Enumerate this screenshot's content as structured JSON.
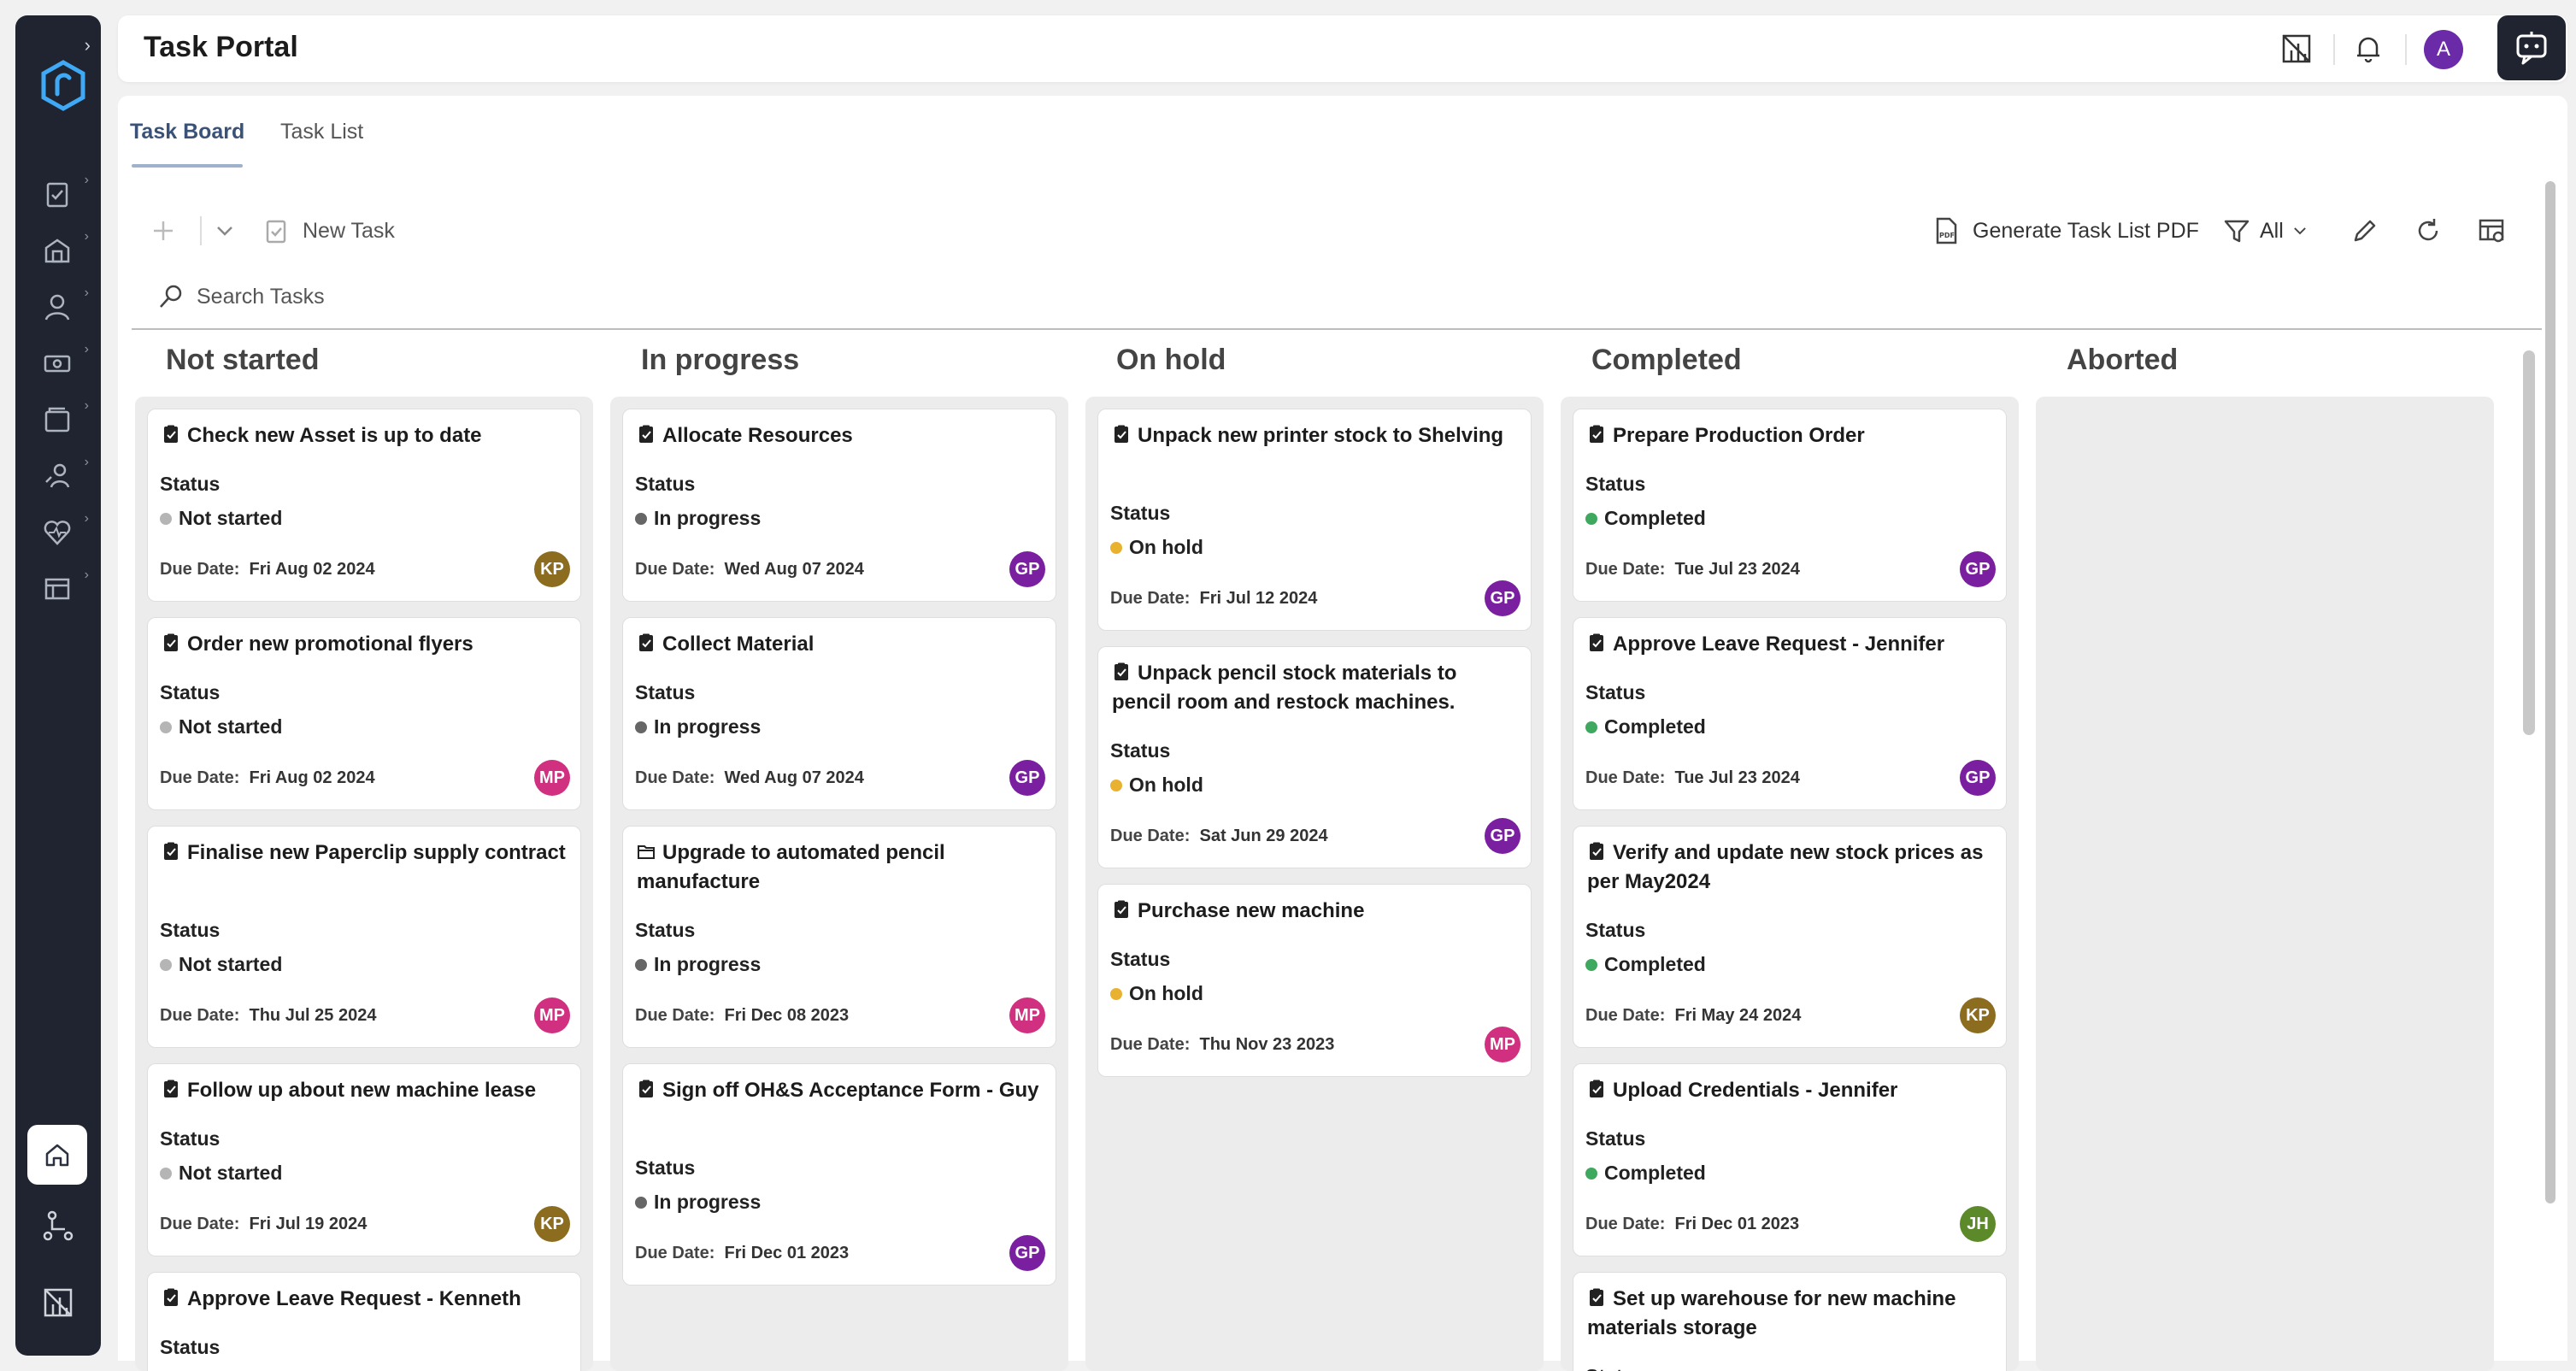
{
  "header": {
    "title": "Task Portal",
    "user_initial": "A"
  },
  "tabs": [
    {
      "label": "Task Board"
    },
    {
      "label": "Task List"
    }
  ],
  "toolbar": {
    "new_task_label": "New Task",
    "generate_pdf_label": "Generate Task List PDF",
    "filter_label": "All"
  },
  "search": {
    "placeholder": "Search Tasks"
  },
  "status_label": "Status",
  "due_prefix": "Due Date:",
  "colors": {
    "not_started": "#b5b5b5",
    "in_progress": "#666666",
    "on_hold": "#e8b130",
    "completed": "#3ea85f",
    "KP": "#8c6d1f",
    "MP": "#d0307f",
    "GP": "#7a1fa0",
    "JH": "#5c8a2a"
  },
  "columns": [
    {
      "title": "Not started",
      "cards": [
        {
          "title": "Check new Asset is up to date",
          "status": "Not started",
          "due": "Fri Aug 02 2024",
          "assignee": "KP"
        },
        {
          "title": "Order new promotional flyers",
          "status": "Not started",
          "due": "Fri Aug 02 2024",
          "assignee": "MP"
        },
        {
          "title": "Finalise new Paperclip supply contract",
          "status": "Not started",
          "due": "Thu Jul 25 2024",
          "assignee": "MP"
        },
        {
          "title": "Follow up about new machine lease",
          "status": "Not started",
          "due": "Fri Jul 19 2024",
          "assignee": "KP"
        },
        {
          "title": "Approve Leave Request - Kenneth",
          "status": "",
          "due": "",
          "assignee": ""
        }
      ]
    },
    {
      "title": "In progress",
      "cards": [
        {
          "title": "Allocate Resources",
          "status": "In progress",
          "due": "Wed Aug 07 2024",
          "assignee": "GP"
        },
        {
          "title": "Collect Material",
          "status": "In progress",
          "due": "Wed Aug 07 2024",
          "assignee": "GP"
        },
        {
          "title": "Upgrade to automated pencil manufacture",
          "status": "In progress",
          "due": "Fri Dec 08 2023",
          "assignee": "MP"
        },
        {
          "title": "Sign off OH&S Acceptance Form - Guy",
          "status": "In progress",
          "due": "Fri Dec 01 2023",
          "assignee": "GP"
        }
      ]
    },
    {
      "title": "On hold",
      "cards": [
        {
          "title": "Unpack new printer stock to Shelving",
          "status": "On hold",
          "due": "Fri Jul 12 2024",
          "assignee": "GP"
        },
        {
          "title": "Unpack pencil stock materials to pencil room and restock machines.",
          "status": "On hold",
          "due": "Sat Jun 29 2024",
          "assignee": "GP"
        },
        {
          "title": "Purchase new machine",
          "status": "On hold",
          "due": "Thu Nov 23 2023",
          "assignee": "MP"
        }
      ]
    },
    {
      "title": "Completed",
      "cards": [
        {
          "title": "Prepare Production Order",
          "status": "Completed",
          "due": "Tue Jul 23 2024",
          "assignee": "GP"
        },
        {
          "title": "Approve Leave Request - Jennifer",
          "status": "Completed",
          "due": "Tue Jul 23 2024",
          "assignee": "GP"
        },
        {
          "title": "Verify and update new stock prices as per May2024",
          "status": "Completed",
          "due": "Fri May 24 2024",
          "assignee": "KP"
        },
        {
          "title": "Upload Credentials - Jennifer",
          "status": "Completed",
          "due": "Fri Dec 01 2023",
          "assignee": "JH"
        },
        {
          "title": "Set up warehouse for new machine materials storage",
          "status": "",
          "due": "",
          "assignee": ""
        }
      ]
    },
    {
      "title": "Aborted",
      "cards": []
    }
  ]
}
